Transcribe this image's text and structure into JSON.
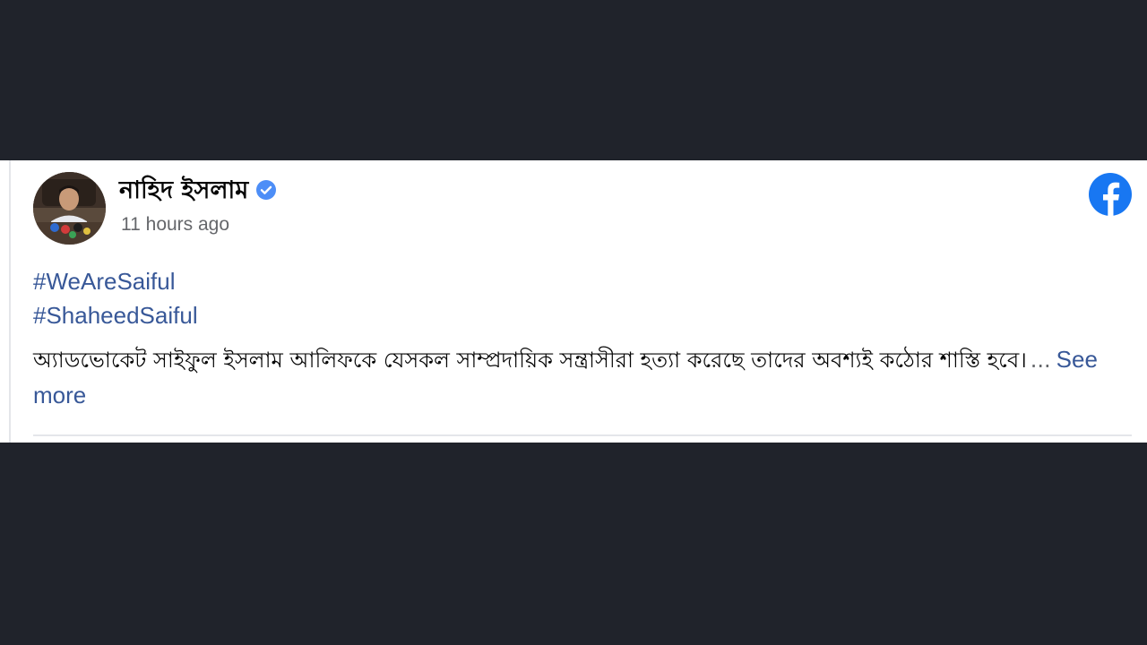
{
  "post": {
    "author_name": "নাহিদ ইসলাম",
    "timestamp": "11 hours ago",
    "hashtags": [
      "#WeAreSaiful",
      "#ShaheedSaiful"
    ],
    "body_text": "অ্যাডভোকেট সাইফুল ইসলাম আলিফকে যেসকল সাম্প্রদায়িক সন্ত্রাসীরা হত্যা করেছে তাদের অবশ্যই কঠোর শাস্তি হবে।",
    "ellipsis": "...",
    "see_more_label": "See more",
    "verified": true
  },
  "icons": {
    "verified": "verified-badge-icon",
    "platform": "facebook-logo-icon"
  },
  "colors": {
    "background": "#20232b",
    "card": "#ffffff",
    "link": "#385898",
    "muted": "#65676b",
    "verified_blue": "#4d8ef7",
    "facebook_blue": "#1877f2"
  }
}
